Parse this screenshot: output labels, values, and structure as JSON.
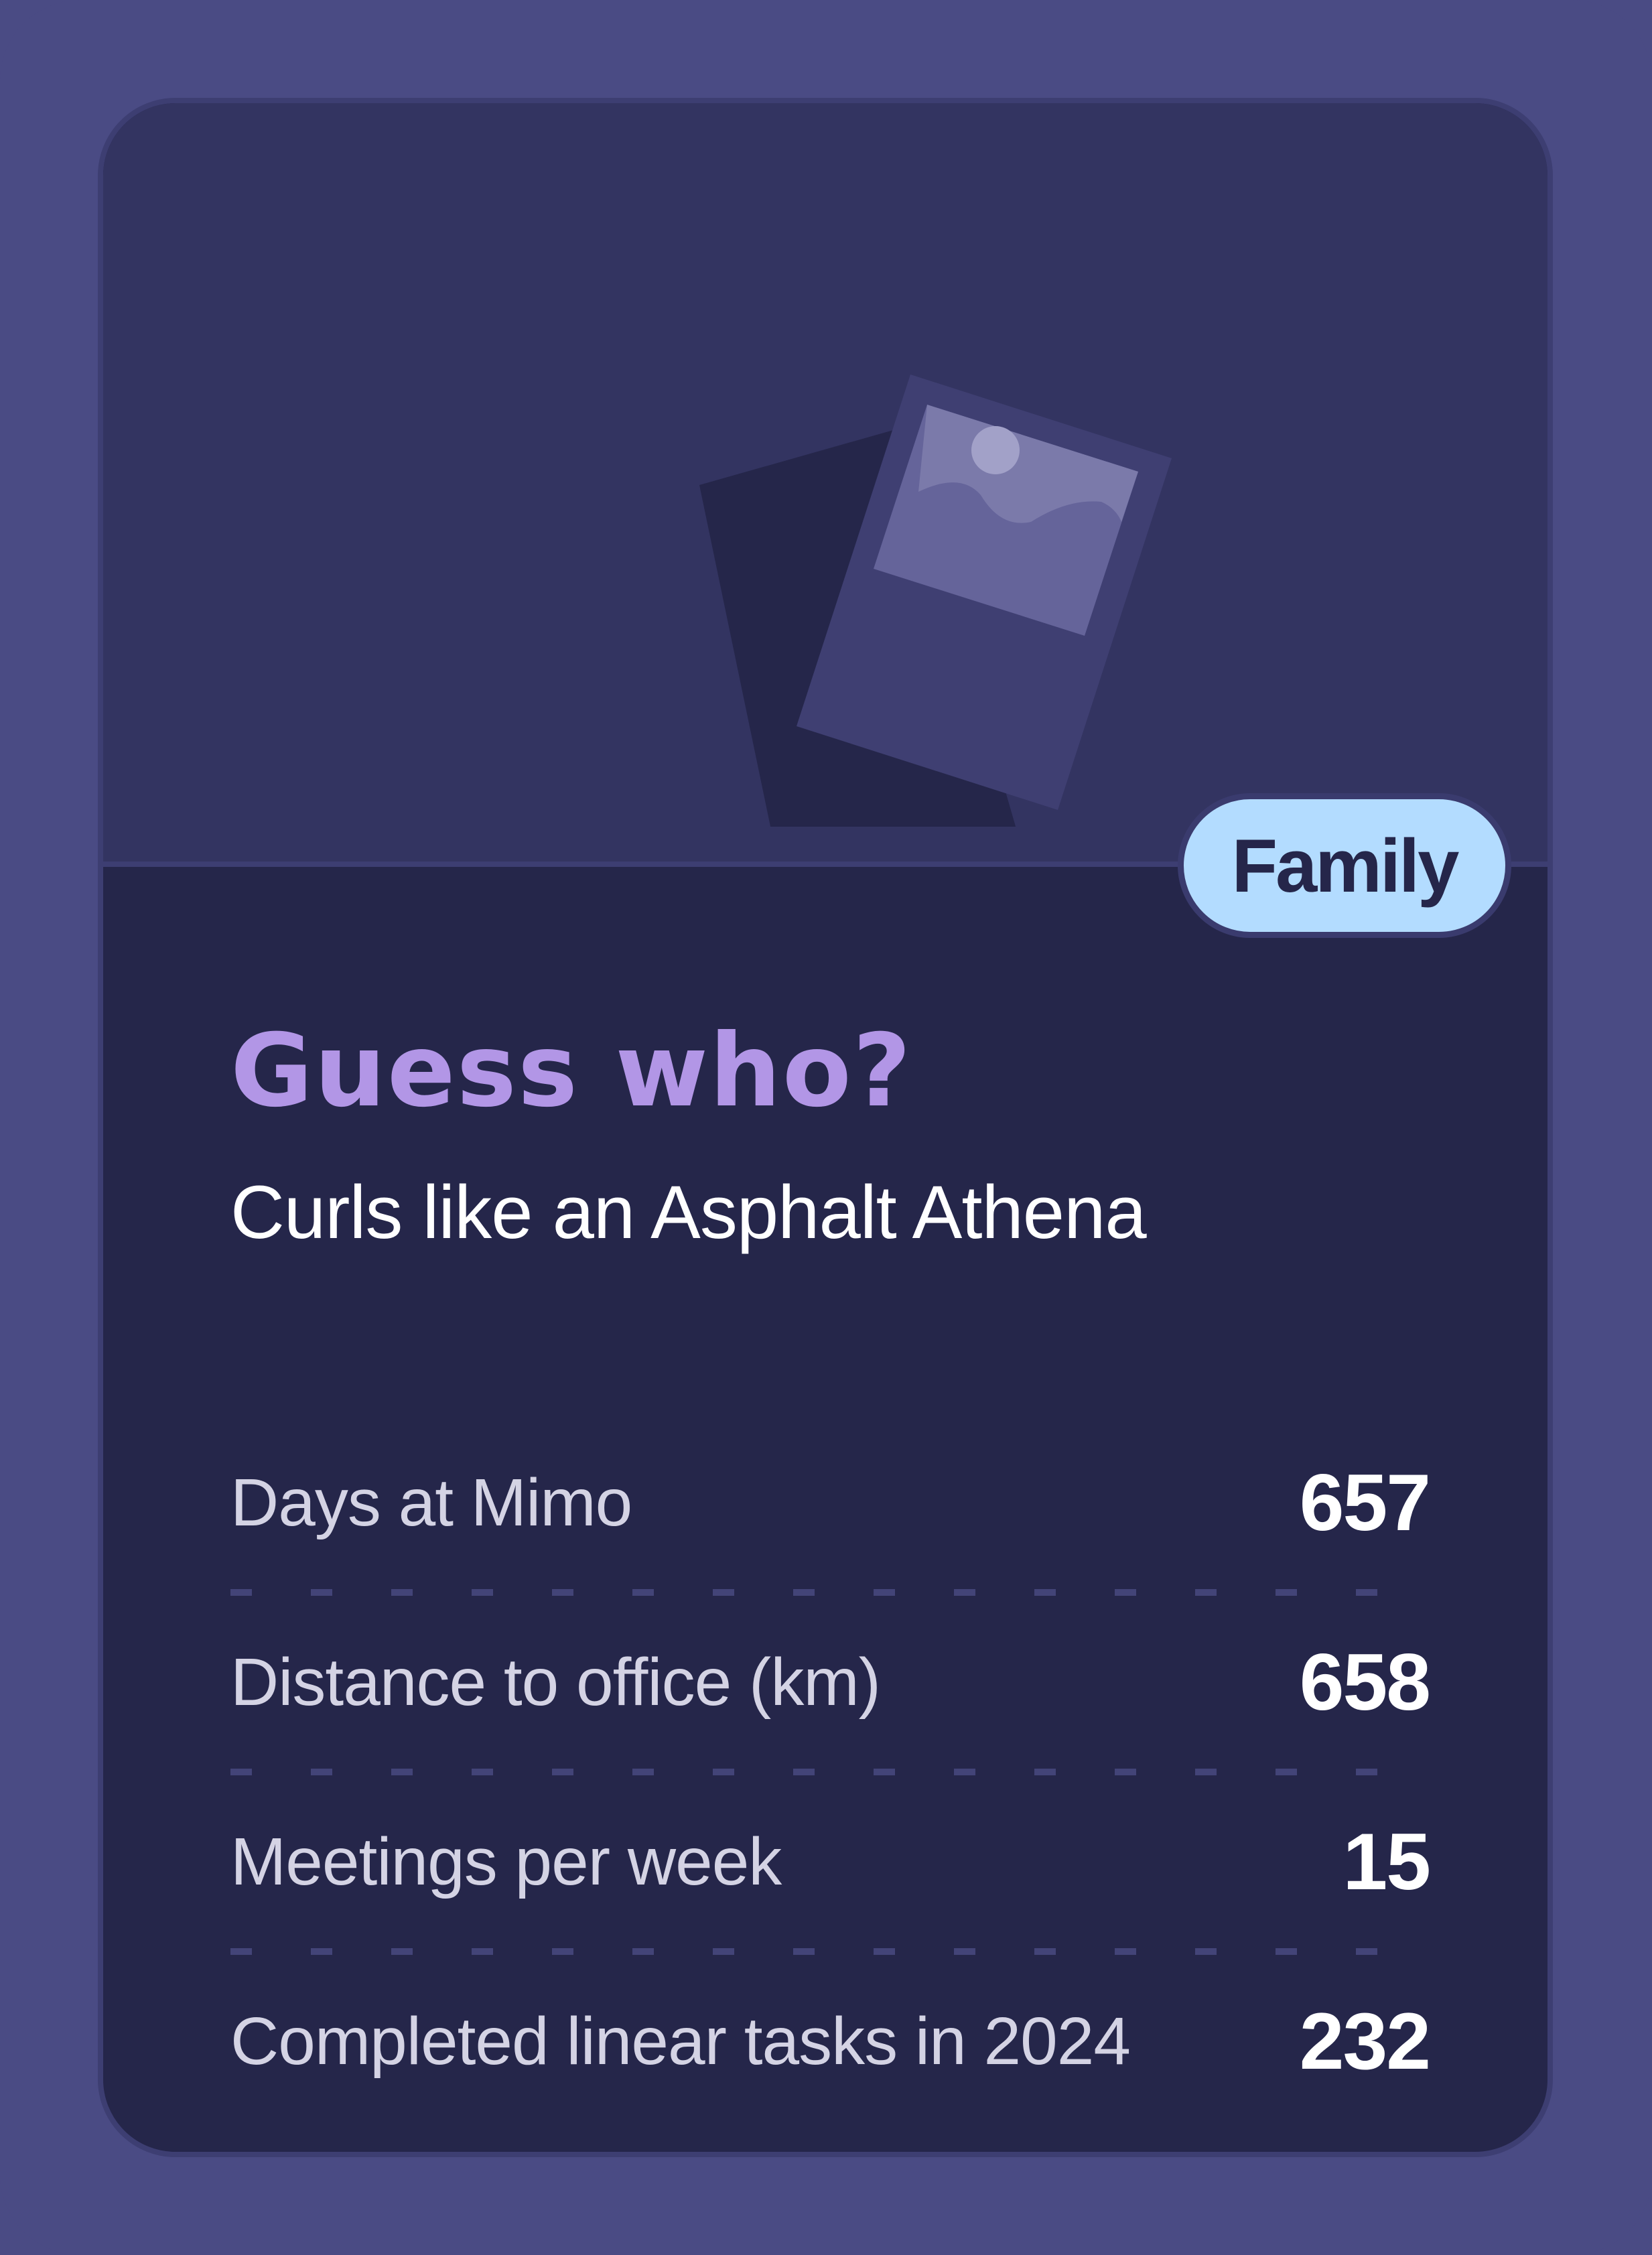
{
  "card": {
    "image_icon": "photo-stack-icon",
    "tag": "Family",
    "title": "Guess who?",
    "subtitle": "Curls like an Asphalt Athena"
  },
  "stats": [
    {
      "label": "Days at Mimo",
      "value": "657"
    },
    {
      "label": "Distance to office (km)",
      "value": "658"
    },
    {
      "label": "Meetings per week",
      "value": "15"
    },
    {
      "label": "Completed linear tasks in 2024",
      "value": "232"
    }
  ],
  "colors": {
    "background": "#4a4b84",
    "card": "#25264a",
    "image_area": "#333461",
    "title": "#b296e6",
    "tag_background": "#b3dcff",
    "tag_text": "#25264a"
  }
}
